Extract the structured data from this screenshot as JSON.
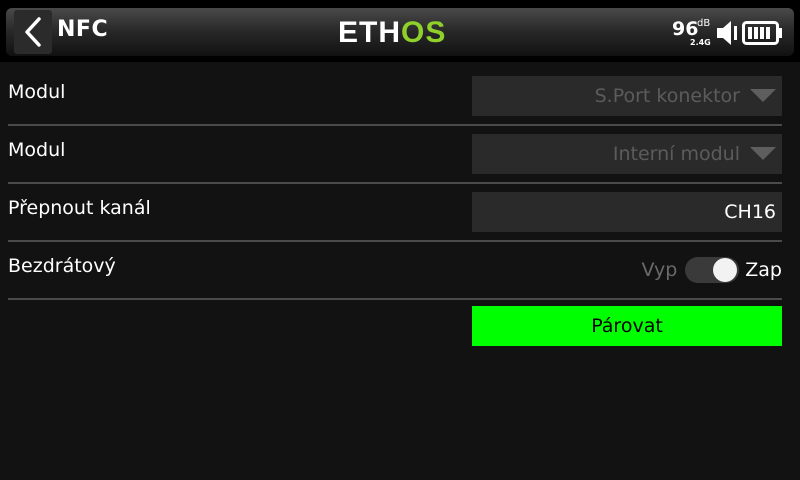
{
  "header": {
    "title": "NFC",
    "logo_left": "ETH",
    "logo_right": "OS",
    "rssi_value": "96",
    "rssi_unit": "dB",
    "band": "2.4G",
    "back_icon": "chevron-left-icon",
    "speaker_icon": "speaker-icon",
    "battery_icon": "battery-icon"
  },
  "rows": [
    {
      "label": "Modul",
      "value": "S.Port konektor"
    },
    {
      "label": "Modul",
      "value": "Interní modul"
    },
    {
      "label": "Přepnout kanál",
      "value": "CH16"
    },
    {
      "label": "Bezdrátový",
      "off_label": "Vyp",
      "on_label": "Zap",
      "state": "on"
    }
  ],
  "bind_button": {
    "label": "Párovat"
  },
  "colors": {
    "background": "#121212",
    "accent_green": "#00ff00",
    "logo_green": "#8fd12a",
    "field_bg": "#2a2a2a",
    "disabled_text": "#5c5c5c"
  }
}
